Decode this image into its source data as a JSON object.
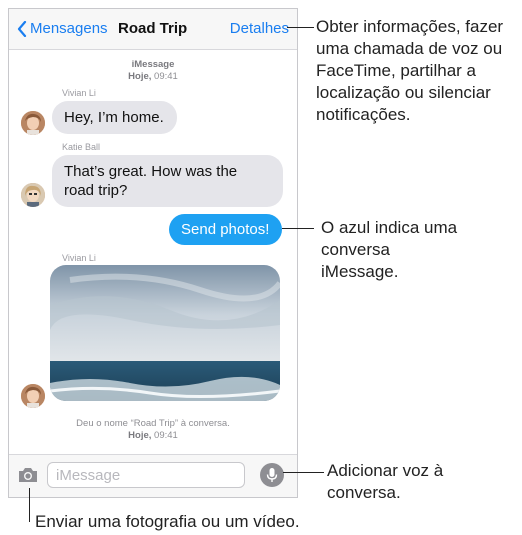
{
  "nav": {
    "back_label": "Mensagens",
    "title": "Road Trip",
    "detail_label": "Detalhes"
  },
  "conversation": {
    "header_service": "iMessage",
    "header_time_day": "Hoje,",
    "header_time": "09:41",
    "messages": [
      {
        "sender": "Vivian Li",
        "text": "Hey, I’m home."
      },
      {
        "sender": "Katie Ball",
        "text": "That’s great. How was the road trip?"
      },
      {
        "sender": "",
        "text": "Send photos!"
      },
      {
        "sender": "Vivian Li",
        "text": ""
      }
    ],
    "rename_notice": "Deu o nome “Road Trip” à conversa.",
    "footer_time_day": "Hoje,",
    "footer_time": "09:41"
  },
  "input": {
    "placeholder": "iMessage"
  },
  "callouts": {
    "details": "Obter informações, fazer uma chamada de voz ou FaceTime, partilhar a localização ou silenciar notificações.",
    "blue": "O azul indica uma conversa iMessage.",
    "voice": "Adicionar voz à conversa.",
    "camera": "Enviar uma fotografia ou um vídeo."
  },
  "colors": {
    "accent": "#1a7ef0",
    "outgoing_bubble": "#1ea1f2",
    "incoming_bubble": "#e5e5ea"
  },
  "icons": {
    "back": "chevron-left-icon",
    "camera": "camera-icon",
    "mic": "microphone-icon"
  }
}
